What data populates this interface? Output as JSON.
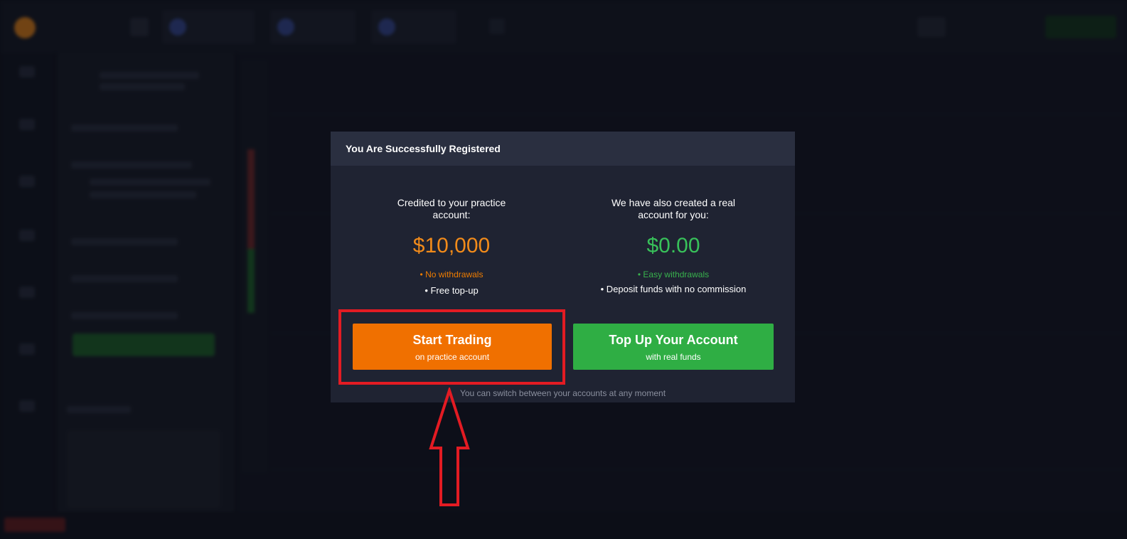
{
  "modal": {
    "title": "You Are Successfully Registered",
    "practice": {
      "heading": "Credited to your practice account:",
      "amount": "$10,000",
      "feature_1": "• No withdrawals",
      "feature_2": "• Free top-up",
      "button_label": "Start Trading",
      "button_sublabel": "on practice account"
    },
    "real": {
      "heading": "We have also created a real account for you:",
      "amount": "$0.00",
      "feature_1": "• Easy withdrawals",
      "feature_2": "• Deposit funds with no commission",
      "button_label": "Top Up Your Account",
      "button_sublabel": "with real funds"
    },
    "footer_note": "You can switch between your accounts at any moment"
  },
  "colors": {
    "practice_accent": "#f07000",
    "real_accent": "#2fae44",
    "annotation": "#e31b23"
  },
  "annotation": {
    "highlight": "red rectangle around Start Trading button",
    "arrow_icon": "up-arrow-icon"
  }
}
